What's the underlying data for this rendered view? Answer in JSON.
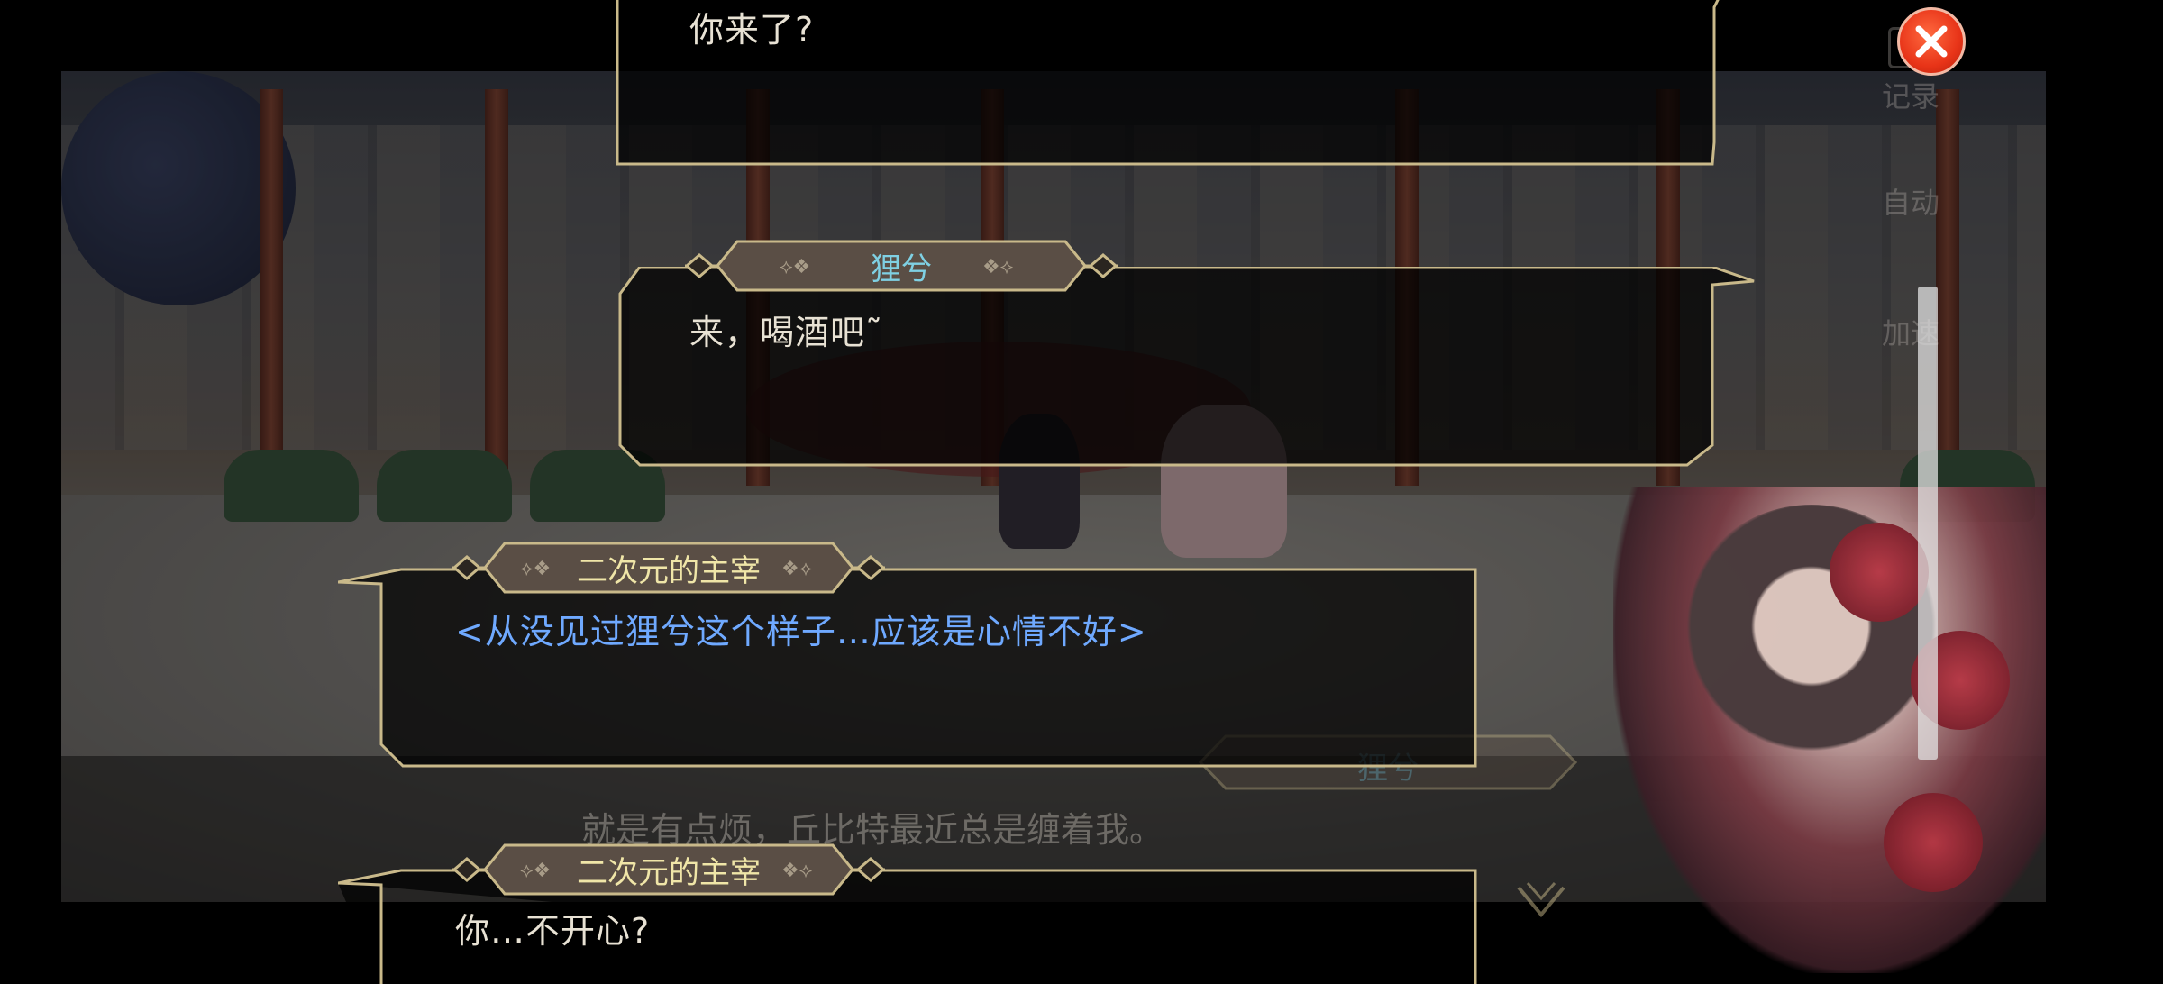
{
  "controls": {
    "close_label": "",
    "log_label": "记录",
    "auto_label": "自动",
    "speed_label": "加速"
  },
  "dialogue_log": [
    {
      "speaker": "",
      "text": "你来了?",
      "speaker_color": "",
      "text_color": "#e8e2d4"
    },
    {
      "speaker": "狸兮",
      "text": "来，喝酒吧˜",
      "speaker_color": "#7fd0e3",
      "text_color": "#e8e2d4"
    },
    {
      "speaker": "二次元的主宰",
      "text": "<从没见过狸兮这个样子…应该是心情不好>",
      "speaker_color": "#f0e6a8",
      "text_color": "#6fa9ff"
    },
    {
      "speaker": "二次元的主宰",
      "text": "你…不开心?",
      "speaker_color": "#f0e6a8",
      "text_color": "#e8e2d4"
    }
  ],
  "background_dialogue": {
    "speaker": "狸兮",
    "text": "就是有点烦，丘比特最近总是缠着我。"
  },
  "colors": {
    "frame_gold": "#c9b98a",
    "plate_fill": "#5a4e45",
    "close_red": "#e83418"
  }
}
